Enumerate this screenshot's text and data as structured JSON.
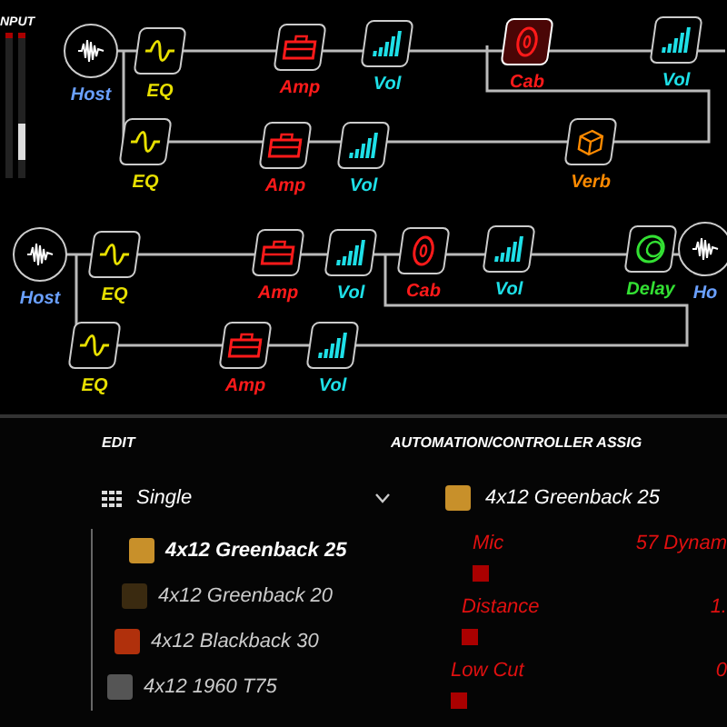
{
  "input_meter": {
    "label": "NPUT"
  },
  "paths": [
    {
      "main_chain": [
        {
          "kind": "host",
          "label": "Host",
          "selected": false
        },
        {
          "kind": "eq",
          "label": "EQ",
          "selected": false
        },
        {
          "kind": "amp",
          "label": "Amp",
          "selected": false
        },
        {
          "kind": "vol",
          "label": "Vol",
          "selected": false
        },
        {
          "kind": "cab",
          "label": "Cab",
          "selected": true
        },
        {
          "kind": "vol",
          "label": "Vol",
          "selected": false
        }
      ],
      "branch_chain": [
        {
          "kind": "eq",
          "label": "EQ",
          "selected": false
        },
        {
          "kind": "amp",
          "label": "Amp",
          "selected": false
        },
        {
          "kind": "vol",
          "label": "Vol",
          "selected": false
        },
        {
          "kind": "verb",
          "label": "Verb",
          "selected": false
        }
      ]
    },
    {
      "main_chain": [
        {
          "kind": "host",
          "label": "Host",
          "selected": false
        },
        {
          "kind": "eq",
          "label": "EQ",
          "selected": false
        },
        {
          "kind": "amp",
          "label": "Amp",
          "selected": false
        },
        {
          "kind": "vol",
          "label": "Vol",
          "selected": false
        },
        {
          "kind": "cab",
          "label": "Cab",
          "selected": false
        },
        {
          "kind": "vol",
          "label": "Vol",
          "selected": false
        },
        {
          "kind": "delay",
          "label": "Delay",
          "selected": false
        },
        {
          "kind": "host",
          "label": "Ho",
          "selected": false
        }
      ],
      "branch_chain": [
        {
          "kind": "eq",
          "label": "EQ",
          "selected": false
        },
        {
          "kind": "amp",
          "label": "Amp",
          "selected": false
        },
        {
          "kind": "vol",
          "label": "Vol",
          "selected": false
        }
      ]
    }
  ],
  "editor": {
    "title": "EDIT",
    "model_type": "Single",
    "models": [
      {
        "name": "4x12 Greenback 25",
        "selected": true,
        "color": "#c8902a"
      },
      {
        "name": "4x12 Greenback 20",
        "selected": false,
        "color": "#3a2a10"
      },
      {
        "name": "4x12 Blackback 30",
        "selected": false,
        "color": "#b0300c"
      },
      {
        "name": "4x12 1960 T75",
        "selected": false,
        "color": "#555555"
      }
    ],
    "assign_title": "AUTOMATION/CONTROLLER ASSIG",
    "block": {
      "name": "4x12 Greenback 25",
      "color": "#c8902a"
    },
    "params": [
      {
        "name": "Mic",
        "value": "57 Dynam"
      },
      {
        "name": "Distance",
        "value": "1."
      },
      {
        "name": "Low Cut",
        "value": "0"
      }
    ]
  }
}
